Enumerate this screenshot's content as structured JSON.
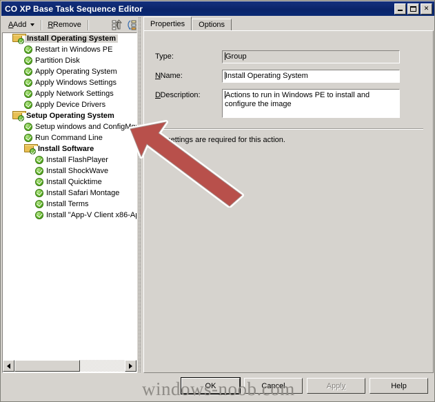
{
  "window": {
    "title": "CO XP Base Task Sequence Editor",
    "controls": {
      "minimize": "minimize-button",
      "maximize": "maximize-button",
      "close": "✕"
    }
  },
  "toolbar": {
    "add_label": "Add",
    "add_accel": "A",
    "remove_label": "Remove",
    "remove_accel": "R",
    "icons": [
      {
        "name": "move-up-icon",
        "title": "Move Up"
      },
      {
        "name": "move-down-icon",
        "title": "Move Down"
      }
    ]
  },
  "tree": {
    "nodes": [
      {
        "label": "Install Operating System",
        "level": 0,
        "icon": "folder-check-icon",
        "type": "group",
        "selected": true
      },
      {
        "label": "Restart in Windows PE",
        "level": 1,
        "icon": "green-check-icon",
        "type": "action",
        "selected": false
      },
      {
        "label": "Partition Disk",
        "level": 1,
        "icon": "green-check-icon",
        "type": "action",
        "selected": false
      },
      {
        "label": "Apply Operating System",
        "level": 1,
        "icon": "green-check-icon",
        "type": "action",
        "selected": false
      },
      {
        "label": "Apply Windows Settings",
        "level": 1,
        "icon": "green-check-icon",
        "type": "action",
        "selected": false
      },
      {
        "label": "Apply Network Settings",
        "level": 1,
        "icon": "green-check-icon",
        "type": "action",
        "selected": false
      },
      {
        "label": "Apply Device Drivers",
        "level": 1,
        "icon": "green-check-icon",
        "type": "action",
        "selected": false
      },
      {
        "label": "Setup Operating System",
        "level": 0,
        "icon": "folder-check-icon",
        "type": "group",
        "selected": false
      },
      {
        "label": "Setup windows and ConfigMgr",
        "level": 1,
        "icon": "green-check-icon",
        "type": "action",
        "selected": false
      },
      {
        "label": "Run Command Line",
        "level": 1,
        "icon": "green-check-icon",
        "type": "action",
        "selected": false
      },
      {
        "label": "Install Software",
        "level": 1,
        "icon": "folder-check-icon",
        "type": "group",
        "selected": false
      },
      {
        "label": "Install FlashPlayer",
        "level": 2,
        "icon": "green-check-icon",
        "type": "action",
        "selected": false
      },
      {
        "label": "Install ShockWave",
        "level": 2,
        "icon": "green-check-icon",
        "type": "action",
        "selected": false
      },
      {
        "label": "Install Quicktime",
        "level": 2,
        "icon": "green-check-icon",
        "type": "action",
        "selected": false
      },
      {
        "label": "Install Safari Montage",
        "level": 2,
        "icon": "green-check-icon",
        "type": "action",
        "selected": false
      },
      {
        "label": "Install Terms",
        "level": 2,
        "icon": "green-check-icon",
        "type": "action",
        "selected": false
      },
      {
        "label": "Install \"App-V Client x86-Ap",
        "level": 2,
        "icon": "green-check-icon",
        "type": "action",
        "selected": false
      }
    ],
    "hscroll": {
      "left_arrow": "◄",
      "right_arrow": "►"
    }
  },
  "tabs": [
    {
      "label": "Properties",
      "active": true
    },
    {
      "label": "Options",
      "active": false
    }
  ],
  "properties": {
    "type_label": "Type:",
    "type_value": "Group",
    "name_label": "Name:",
    "name_accel": "N",
    "name_value": "Install Operating System",
    "description_label": "Description:",
    "description_accel": "D",
    "description_value": "Actions to run in Windows PE to install and configure the image",
    "note": "No settings are required  for this action."
  },
  "buttons": [
    {
      "label": "OK",
      "name": "ok-button",
      "default": true,
      "disabled": false,
      "accel": ""
    },
    {
      "label": "Cancel",
      "name": "cancel-button",
      "default": false,
      "disabled": false,
      "accel": ""
    },
    {
      "label": "Apply",
      "name": "apply-button",
      "default": false,
      "disabled": true,
      "accel": "y"
    },
    {
      "label": "Help",
      "name": "help-button",
      "default": false,
      "disabled": false,
      "accel": ""
    }
  ],
  "watermark": "windows-noob.com",
  "colors": {
    "titlebar": "#0a246a",
    "face": "#d6d3ce",
    "arrow": "#b8504b",
    "arrow_outline": "#ffffff",
    "check_green": "#55a823",
    "folder_yellow": "#e8bf54",
    "watermark": "#8e8b86"
  }
}
